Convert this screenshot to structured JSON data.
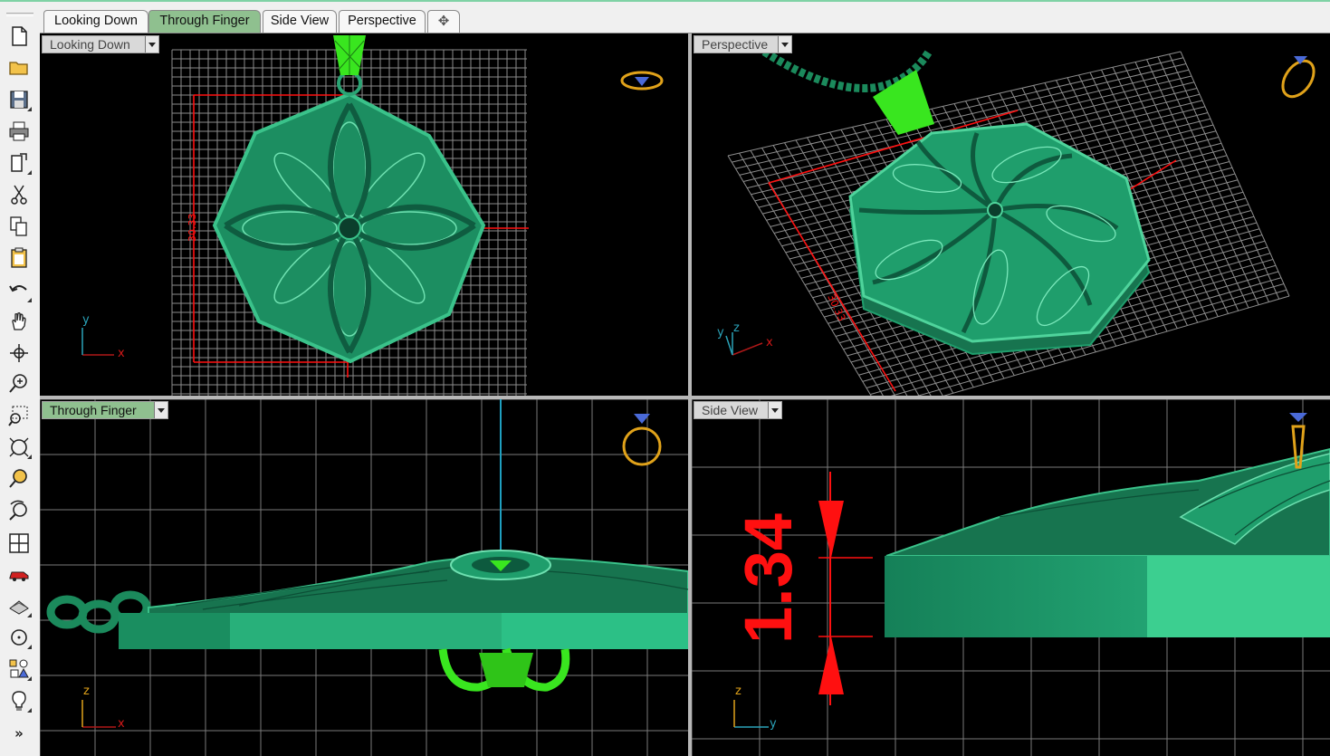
{
  "tabs": [
    {
      "label": "Looking Down",
      "active": false
    },
    {
      "label": "Through Finger",
      "active": true
    },
    {
      "label": "Side View",
      "active": false
    },
    {
      "label": "Perspective",
      "active": false
    }
  ],
  "add_tab_symbol": "✥",
  "toolbar": {
    "tools": [
      "new-document-icon",
      "open-folder-icon",
      "save-icon",
      "print-icon",
      "export-icon",
      "cut-icon",
      "copy-icon",
      "paste-icon",
      "undo-icon",
      "pan-hand-icon",
      "rotate-view-icon",
      "zoom-icon",
      "zoom-window-icon",
      "zoom-extents-icon",
      "zoom-selected-icon",
      "rotate-camera-icon",
      "four-viewports-icon",
      "car-icon",
      "render-icon",
      "circle-icon",
      "shapes-icon",
      "lightbulb-icon"
    ],
    "more_label": "»"
  },
  "viewports": {
    "top_left": {
      "label": "Looking Down",
      "dimension": "30.33",
      "axes": {
        "v": "y",
        "h": "x"
      }
    },
    "top_right": {
      "label": "Perspective",
      "dimension": "30.33",
      "axes": {
        "v": "y",
        "z": "z",
        "h": "x"
      }
    },
    "bottom_left": {
      "label": "Through Finger",
      "axes": {
        "v": "z",
        "h": "x"
      }
    },
    "bottom_right": {
      "label": "Side View",
      "dimension": "1.34",
      "axes": {
        "v": "z",
        "h": "y"
      }
    }
  },
  "colors": {
    "model_green": "#1f9e6c",
    "bail_green": "#39e61f",
    "dimension_red": "#ff1010",
    "grid_white": "#9a9a9a",
    "ring_gold": "#e0a21a",
    "viewport_bg": "#000000",
    "active_tab": "#8fc08f"
  }
}
